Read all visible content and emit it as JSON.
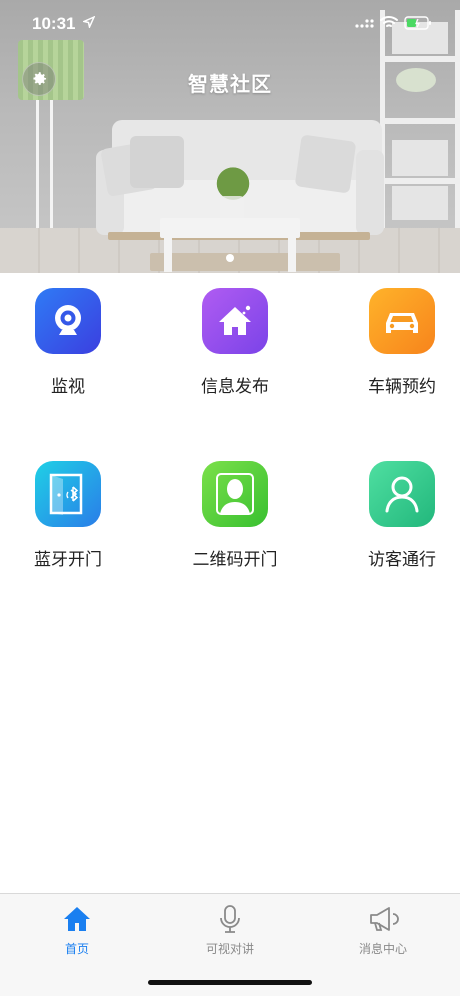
{
  "status_bar": {
    "time": "10:31"
  },
  "header": {
    "title": "智慧社区"
  },
  "features": [
    {
      "label": "监视",
      "icon": "camera-icon",
      "colors": [
        "#2f7bf5",
        "#3b3fe0"
      ]
    },
    {
      "label": "信息发布",
      "icon": "home-icon",
      "colors": [
        "#b05cf2",
        "#7b43e8"
      ]
    },
    {
      "label": "车辆预约",
      "icon": "car-icon",
      "colors": [
        "#ffb32a",
        "#f7841c"
      ]
    },
    {
      "label": "蓝牙开门",
      "icon": "bluetooth-door-icon",
      "colors": [
        "#1fd0e6",
        "#2a7de8"
      ]
    },
    {
      "label": "二维码开门",
      "icon": "person-icon",
      "colors": [
        "#7be04a",
        "#38c030"
      ]
    },
    {
      "label": "访客通行",
      "icon": "visitor-icon",
      "colors": [
        "#4fdfa1",
        "#22b77c"
      ]
    }
  ],
  "tab_bar": {
    "active_color": "#1a7ff0",
    "inactive_color": "#8a8a8a",
    "tabs": [
      {
        "label": "首页",
        "icon": "home-tab-icon",
        "active": true
      },
      {
        "label": "可视对讲",
        "icon": "microphone-icon",
        "active": false
      },
      {
        "label": "消息中心",
        "icon": "megaphone-icon",
        "active": false
      }
    ]
  }
}
